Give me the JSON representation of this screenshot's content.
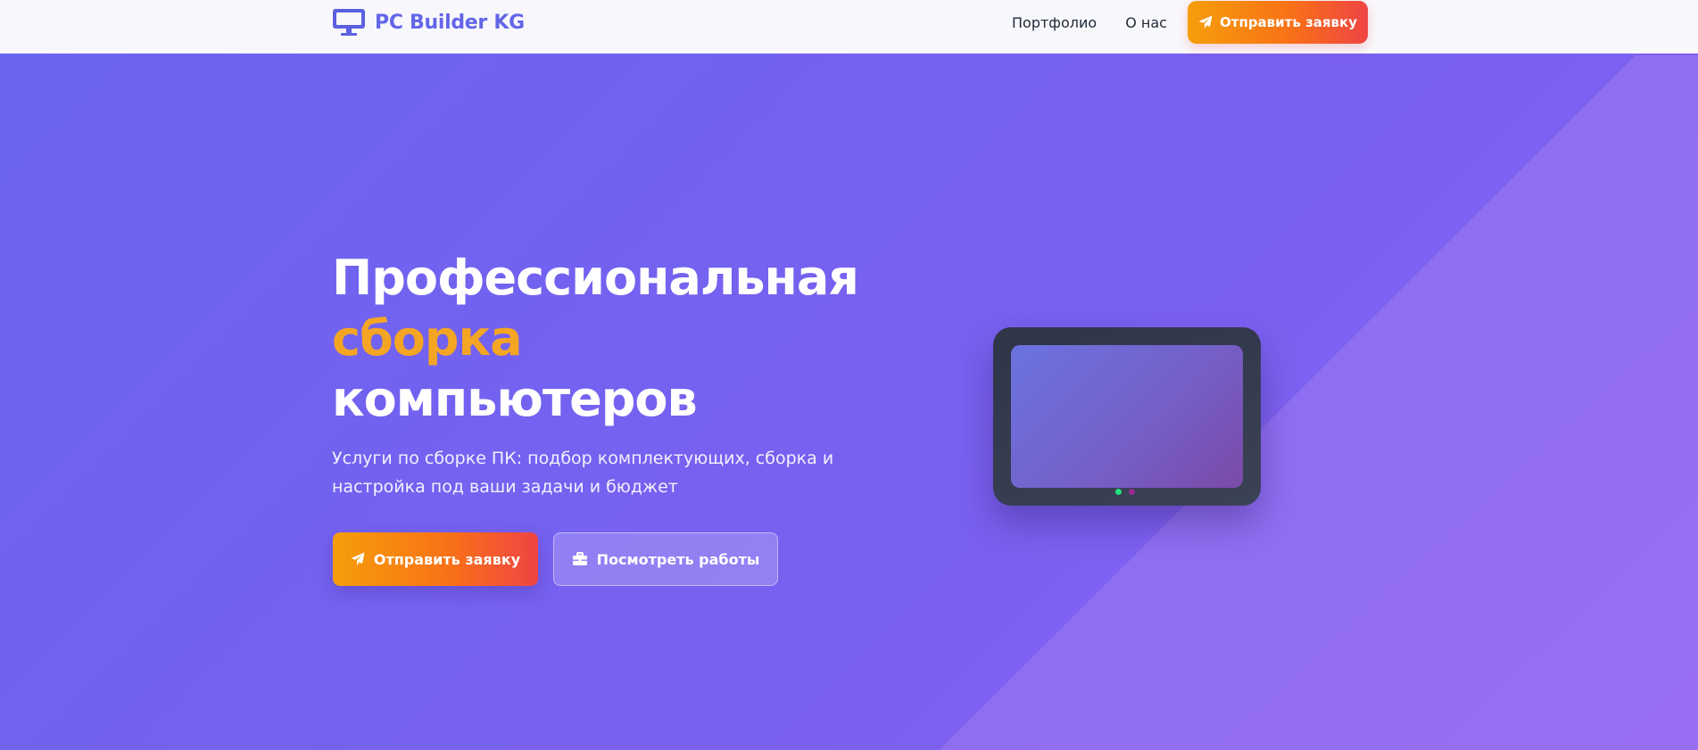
{
  "header": {
    "logo_text": "PC Builder KG",
    "logo_icon": "monitor-icon",
    "nav": [
      {
        "label": "Портфолио"
      },
      {
        "label": "О нас"
      }
    ],
    "cta_label": "Отправить заявку",
    "cta_icon": "paper-plane-icon"
  },
  "hero": {
    "title_line1": "Профессиональная",
    "title_line2": "сборка",
    "title_line3": "компьютеров",
    "subtitle": "Услуги по сборке ПК: подбор комплектующих, сборка и настройка под ваши задачи и бюджет",
    "primary_button": {
      "label": "Отправить заявку",
      "icon": "paper-plane-icon"
    },
    "secondary_button": {
      "label": "Посмотреть работы",
      "icon": "briefcase-icon"
    },
    "illustration": "monitor-illustration"
  },
  "colors": {
    "brand": "#6366e8",
    "accent": "#f5a524",
    "cta_gradient_start": "#f59e0b",
    "cta_gradient_end": "#ef4444",
    "hero_bg_start": "#6a65ef",
    "hero_bg_end": "#8a64f2"
  }
}
